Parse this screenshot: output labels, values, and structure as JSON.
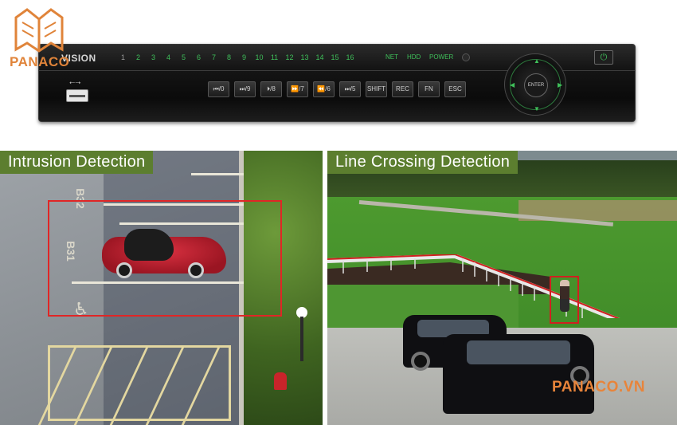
{
  "logo": {
    "text": "PANACO"
  },
  "device": {
    "brand": "VISION",
    "channels": [
      "1",
      "2",
      "3",
      "4",
      "5",
      "6",
      "7",
      "8",
      "9",
      "10",
      "11",
      "12",
      "13",
      "14",
      "15",
      "16"
    ],
    "status": {
      "net": "NET",
      "hdd": "HDD",
      "power": "POWER"
    },
    "usb_icon": "usb-icon",
    "keys": [
      "⏮/0",
      "⏭/9",
      "⏵/8",
      "⏩/7",
      "⏪/6",
      "⏭/5",
      "SHIFT",
      "REC",
      "FN",
      "ESC"
    ],
    "dpad_center": "ENTER",
    "colors": {
      "led_green": "#3fbf5a",
      "body": "#111111"
    }
  },
  "panels": {
    "left": {
      "title": "Intrusion Detection",
      "marks": [
        "B32",
        "B31"
      ]
    },
    "right": {
      "title": "Line Crossing Detection",
      "watermark": "PANACO.VN"
    }
  },
  "colors": {
    "title_bg": "#5c7e2f",
    "detection_red": "#e02626",
    "brand_orange": "#e0843a"
  }
}
